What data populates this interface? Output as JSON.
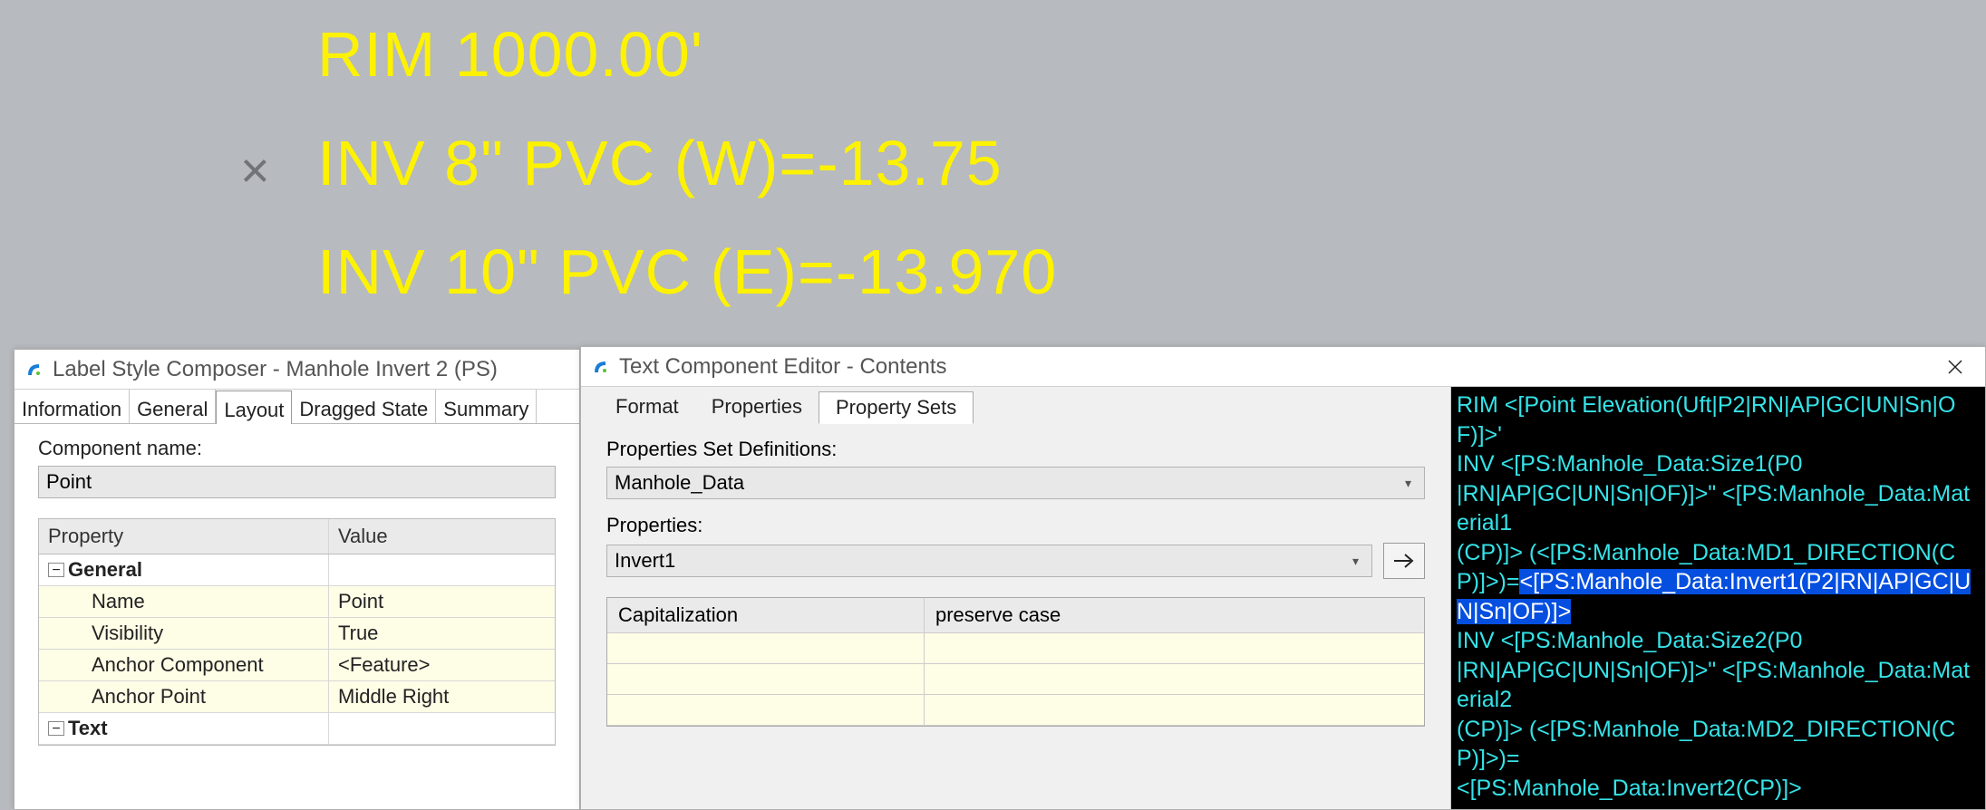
{
  "cad": {
    "line1": "RIM 1000.00'",
    "line2": "INV 8\" PVC (W)=-13.75",
    "line3": "INV 10\" PVC (E)=-13.970",
    "marker": "×"
  },
  "lsc": {
    "title": "Label Style Composer - Manhole Invert 2 (PS)",
    "tabs": [
      "Information",
      "General",
      "Layout",
      "Dragged State",
      "Summary"
    ],
    "active_tab": "Layout",
    "component_name_label": "Component name:",
    "component_name_value": "Point",
    "grid_head_prop": "Property",
    "grid_head_val": "Value",
    "groups": [
      {
        "name": "General",
        "rows": [
          {
            "prop": "Name",
            "val": "Point"
          },
          {
            "prop": "Visibility",
            "val": "True"
          },
          {
            "prop": "Anchor Component",
            "val": "<Feature>"
          },
          {
            "prop": "Anchor Point",
            "val": "Middle Right"
          }
        ]
      },
      {
        "name": "Text",
        "rows": []
      }
    ]
  },
  "tce": {
    "title": "Text Component Editor - Contents",
    "tabs": [
      "Format",
      "Properties",
      "Property Sets"
    ],
    "active_tab": "Property Sets",
    "psd_label": "Properties Set Definitions:",
    "psd_value": "Manhole_Data",
    "props_label": "Properties:",
    "props_value": "Invert1",
    "mini_head1": "Capitalization",
    "mini_head2": "preserve case",
    "code_pre": "RIM <[Point Elevation(Uft|P2|RN|AP|GC|UN|Sn|OF)]>'\nINV <[PS:Manhole_Data:Size1(P0\n|RN|AP|GC|UN|Sn|OF)]>\" <[PS:Manhole_Data:Material1\n(CP)]> (<[PS:Manhole_Data:MD1_DIRECTION(CP)]>)=",
    "code_sel": "<[PS:Manhole_Data:Invert1(P2|RN|AP|GC|UN|Sn|OF)]>",
    "code_post": "\nINV <[PS:Manhole_Data:Size2(P0\n|RN|AP|GC|UN|Sn|OF)]>\" <[PS:Manhole_Data:Material2\n(CP)]> (<[PS:Manhole_Data:MD2_DIRECTION(CP)]>)=\n<[PS:Manhole_Data:Invert2(CP)]>"
  }
}
